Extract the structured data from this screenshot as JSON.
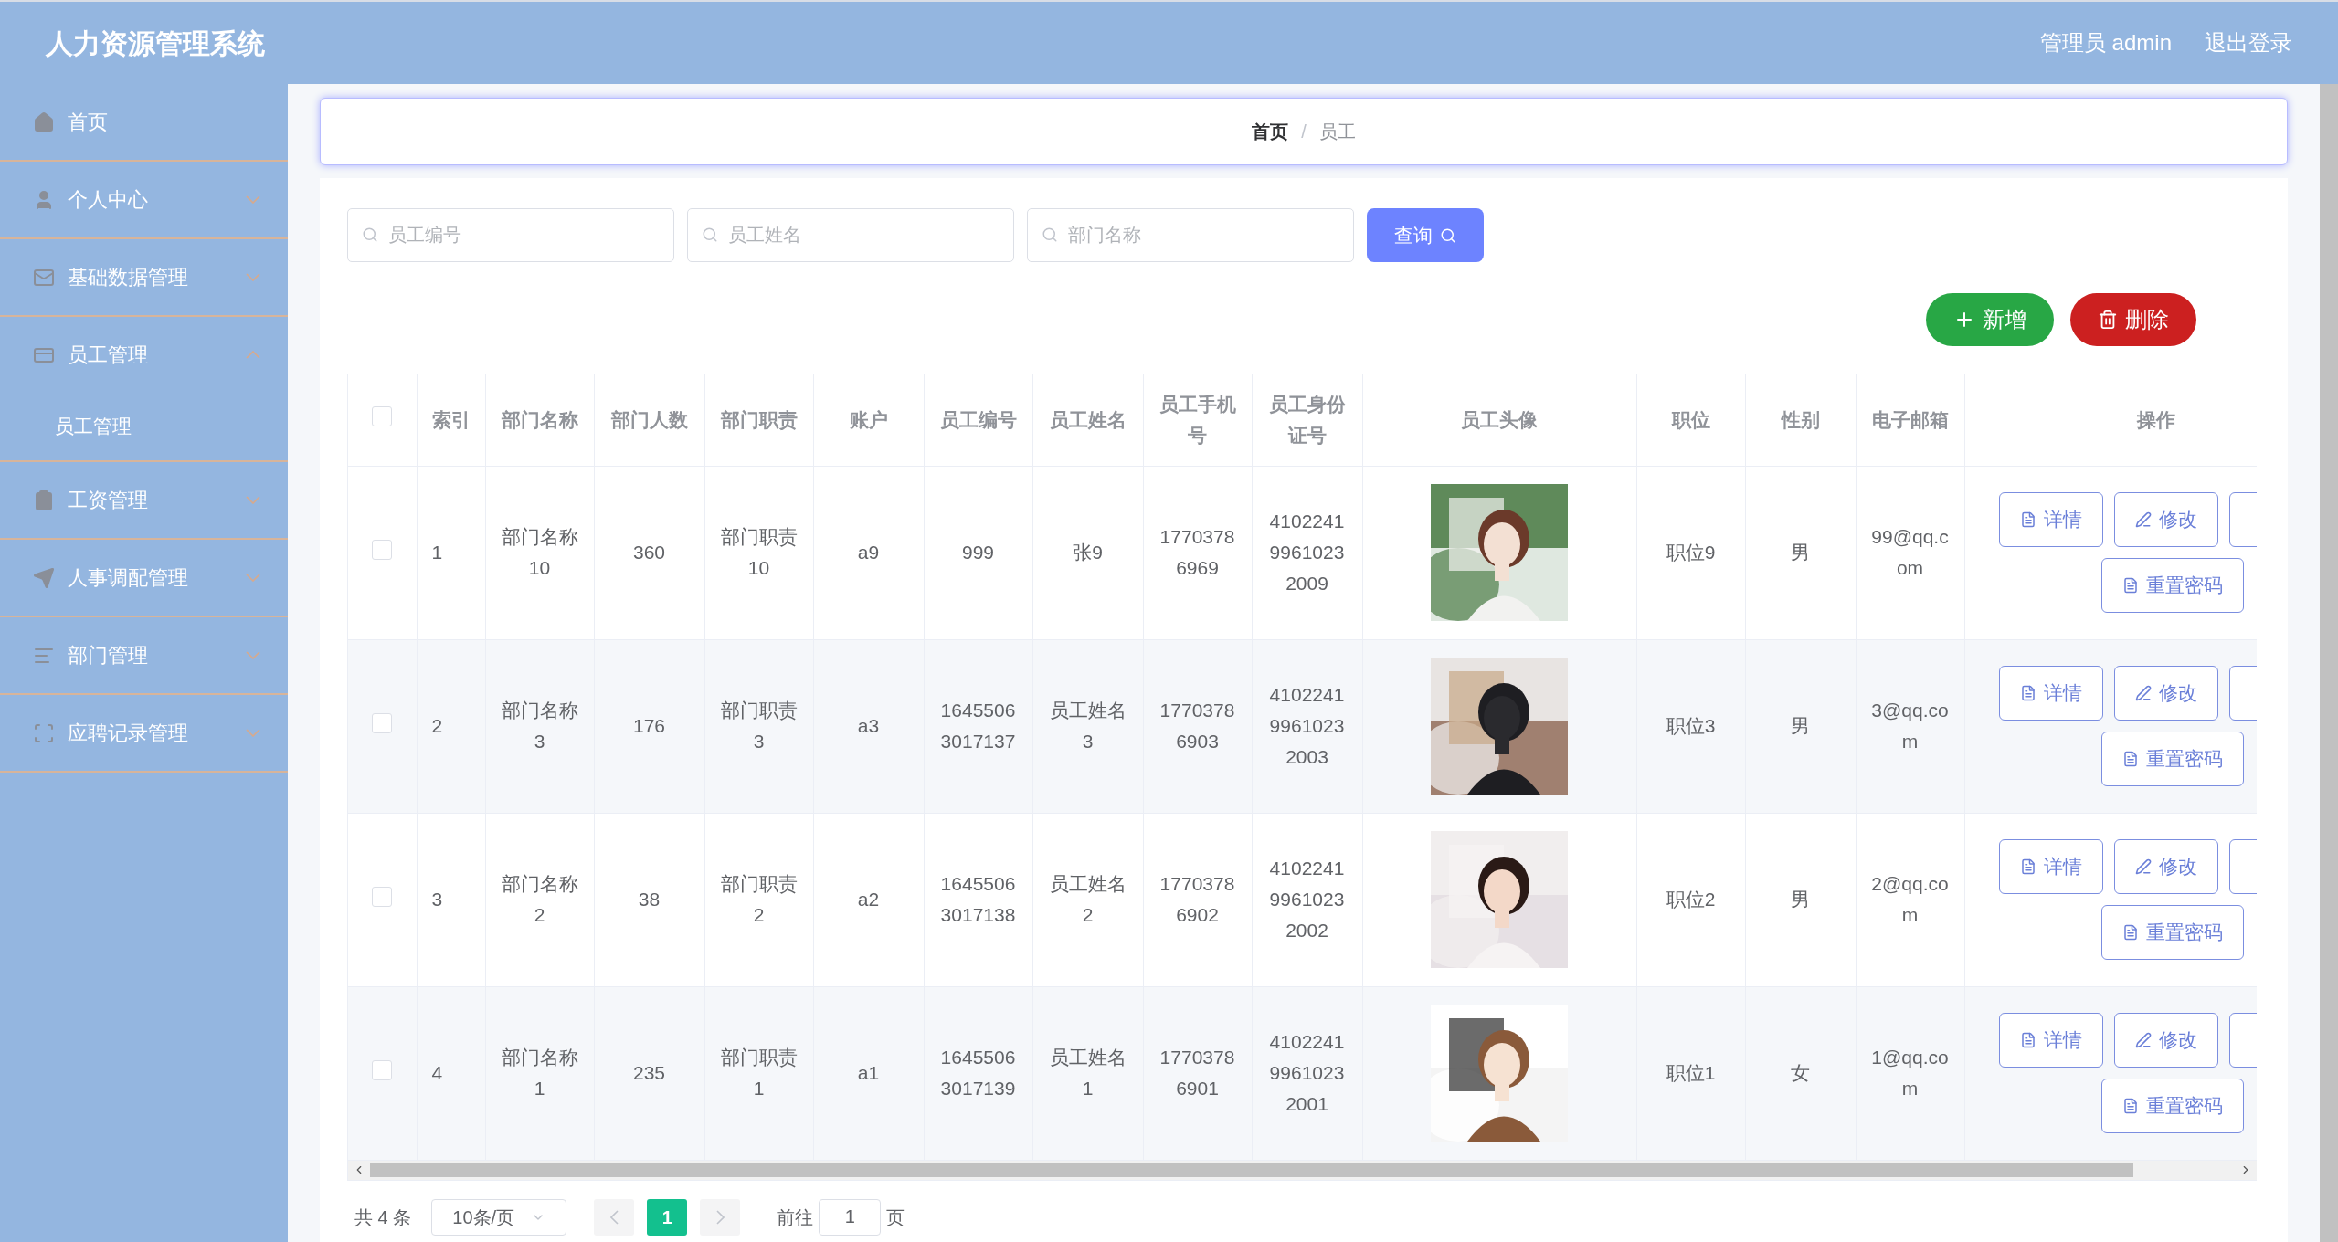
{
  "header": {
    "title": "人力资源管理系统",
    "user": "管理员 admin",
    "logout": "退出登录"
  },
  "sidebar": {
    "items": [
      {
        "label": "首页",
        "kind": "link"
      },
      {
        "label": "个人中心",
        "kind": "menu",
        "expanded": false
      },
      {
        "label": "基础数据管理",
        "kind": "menu",
        "expanded": false
      },
      {
        "label": "员工管理",
        "kind": "menu",
        "expanded": true,
        "children": [
          {
            "label": "员工管理"
          }
        ]
      },
      {
        "label": "工资管理",
        "kind": "menu",
        "expanded": false
      },
      {
        "label": "人事调配管理",
        "kind": "menu",
        "expanded": false
      },
      {
        "label": "部门管理",
        "kind": "menu",
        "expanded": false
      },
      {
        "label": "应聘记录管理",
        "kind": "menu",
        "expanded": false
      }
    ]
  },
  "breadcrumb": [
    "首页",
    "员工"
  ],
  "breadcrumb_separator": "/",
  "search": {
    "fields": [
      {
        "placeholder": "员工编号"
      },
      {
        "placeholder": "员工姓名"
      },
      {
        "placeholder": "部门名称"
      }
    ],
    "button": "查询"
  },
  "toolbar": {
    "add": "新增",
    "delete": "删除"
  },
  "table": {
    "all_checked": false,
    "columns": [
      "索引",
      "部门名称",
      "部门人数",
      "部门职责",
      "账户",
      "员工编号",
      "员工姓名",
      "员工手机号",
      "员工身份证号",
      "员工头像",
      "职位",
      "性别",
      "电子邮箱",
      "操作"
    ],
    "rows": [
      {
        "checked": false,
        "cells": [
          "1",
          "部门名称10",
          "360",
          "部门职责10",
          "a9",
          "999",
          "张9",
          "17703786969",
          "410224199610232009"
        ],
        "photo": {
          "kind": "picture"
        },
        "tail": [
          "职位9",
          "男",
          "99@qq.com"
        ],
        "actions": [
          "详情",
          "修改",
          "重置密码"
        ]
      },
      {
        "checked": false,
        "cells": [
          "2",
          "部门名称3",
          "176",
          "部门职责3",
          "a3",
          "16455063017137",
          "员工姓名3",
          "17703786903",
          "410224199610232003"
        ],
        "photo": {
          "kind": "picture"
        },
        "tail": [
          "职位3",
          "男",
          "3@qq.com"
        ],
        "actions": [
          "详情",
          "修改",
          "重置密码"
        ]
      },
      {
        "checked": false,
        "cells": [
          "3",
          "部门名称2",
          "38",
          "部门职责2",
          "a2",
          "16455063017138",
          "员工姓名2",
          "17703786902",
          "410224199610232002"
        ],
        "photo": {
          "kind": "picture"
        },
        "tail": [
          "职位2",
          "男",
          "2@qq.com"
        ],
        "actions": [
          "详情",
          "修改",
          "重置密码"
        ]
      },
      {
        "checked": false,
        "cells": [
          "4",
          "部门名称1",
          "235",
          "部门职责1",
          "a1",
          "16455063017139",
          "员工姓名1",
          "17703786901",
          "410224199610232001"
        ],
        "photo": {
          "kind": "picture"
        },
        "tail": [
          "职位1",
          "女",
          "1@qq.com"
        ],
        "actions": [
          "详情",
          "修改",
          "重置密码"
        ]
      }
    ]
  },
  "pagination": {
    "total": "共 4 条",
    "page_size": "10条/页",
    "pages": [
      {
        "label": "1",
        "selected": true
      }
    ],
    "goto": "前往",
    "goto_value": "1",
    "page_unit": "页"
  }
}
